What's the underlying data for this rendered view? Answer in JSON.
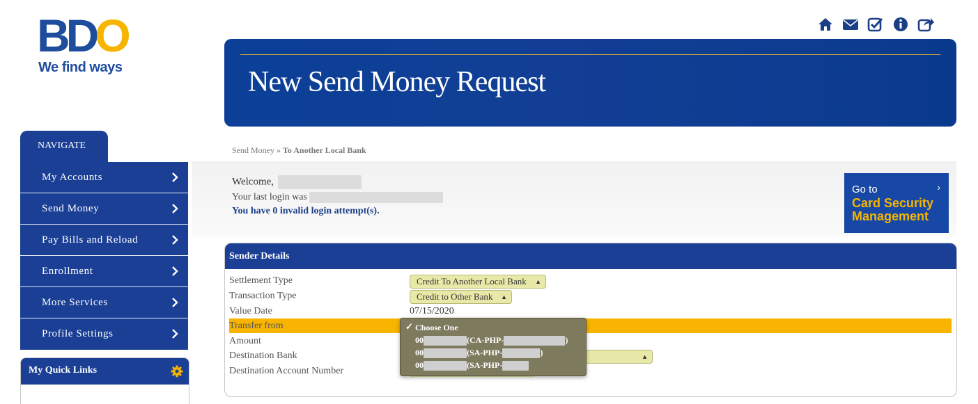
{
  "logo": {
    "text_bd": "BD",
    "text_o": "O",
    "tagline": "We find ways"
  },
  "top_icons": [
    "home-icon",
    "mail-icon",
    "checkbox-icon",
    "info-icon",
    "share-icon"
  ],
  "banner": {
    "title": "New Send Money Request"
  },
  "breadcrumb": {
    "parent": "Send Money",
    "separator": "»",
    "current": "To Another Local Bank"
  },
  "welcome": {
    "greeting": "Welcome,",
    "last_login_label": "Your last login was",
    "invalid_attempts": "You have 0 invalid login attempt(s)."
  },
  "card_security": {
    "go_to": "Go to",
    "arrow": "›",
    "line1": "Card Security",
    "line2": "Management"
  },
  "sidebar": {
    "tab": "NAVIGATE",
    "items": [
      {
        "label": "My Accounts"
      },
      {
        "label": "Send Money"
      },
      {
        "label": "Pay Bills and Reload"
      },
      {
        "label": "Enrollment"
      },
      {
        "label": "More Services"
      },
      {
        "label": "Profile Settings"
      }
    ],
    "quick_links": "My Quick Links"
  },
  "sender_details": {
    "title": "Sender Details",
    "settlement_type_label": "Settlement Type",
    "settlement_type_value": "Credit To Another Local Bank",
    "transaction_type_label": "Transaction Type",
    "transaction_type_value": "Credit to Other Bank",
    "value_date_label": "Value Date",
    "value_date": "07/15/2020",
    "transfer_from_label": "Transfer from",
    "amount_label": "Amount",
    "destination_bank_label": "Destination Bank",
    "destination_account_label": "Destination Account Number"
  },
  "transfer_dropdown": {
    "check": "✓",
    "options": [
      {
        "label": "Choose One"
      },
      {
        "prefix": "00",
        "mid": "(CA-PHP-",
        "suffix": ")"
      },
      {
        "prefix": "00",
        "mid": "(SA-PHP-",
        "suffix": ")"
      },
      {
        "prefix": "00",
        "mid": "(SA-PHP-",
        "suffix": ""
      }
    ]
  },
  "colors": {
    "brand_blue": "#1a3f95",
    "accent_yellow": "#f8b400",
    "banner_blue": "#0b3f98"
  }
}
